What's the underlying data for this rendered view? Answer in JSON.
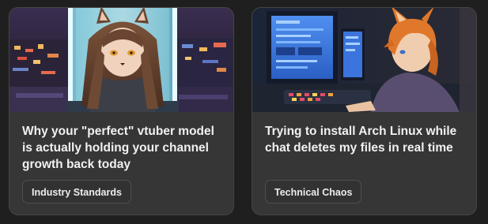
{
  "cards": [
    {
      "title": "Why your \"perfect\" vtuber model is actually holding your channel growth back today",
      "tag": "Industry Standards",
      "thumbnail": "anime-fox-girl-in-glass-tube-art"
    },
    {
      "title": "Trying to install Arch Linux while chat deletes my files in real time",
      "tag": "Technical Chaos",
      "thumbnail": "fox-eared-boy-at-computer-monitors-art"
    }
  ]
}
